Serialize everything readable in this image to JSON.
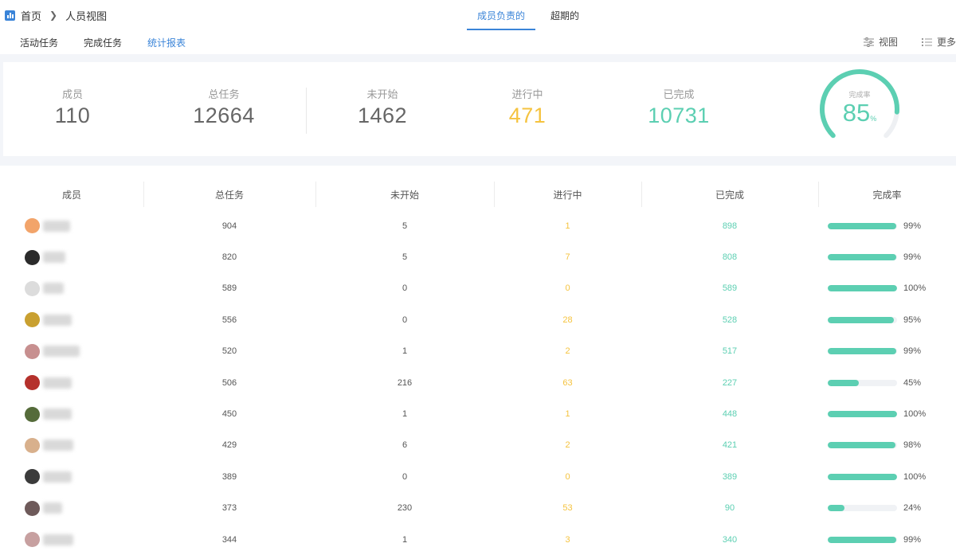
{
  "breadcrumb": {
    "home": "首页",
    "current": "人员视图"
  },
  "top_tabs": [
    {
      "label": "成员负责的",
      "active": true
    },
    {
      "label": "超期的",
      "active": false
    }
  ],
  "sub_tabs": [
    {
      "label": "活动任务",
      "active": false
    },
    {
      "label": "完成任务",
      "active": false
    },
    {
      "label": "统计报表",
      "active": true
    }
  ],
  "tools": {
    "view_label": "视图",
    "more_label": "更多"
  },
  "stats": {
    "members": {
      "label": "成员",
      "value": "110"
    },
    "total": {
      "label": "总任务",
      "value": "12664"
    },
    "not_started": {
      "label": "未开始",
      "value": "1462"
    },
    "in_progress": {
      "label": "进行中",
      "value": "471"
    },
    "completed": {
      "label": "已完成",
      "value": "10731"
    },
    "rate": {
      "label": "完成率",
      "value": "85",
      "unit": "%",
      "fraction": 0.85
    }
  },
  "colors": {
    "accent": "#3a84d8",
    "in_progress": "#f5c33f",
    "completed": "#5ccfb2",
    "muted": "#999999"
  },
  "table": {
    "headers": [
      "成员",
      "总任务",
      "未开始",
      "进行中",
      "已完成",
      "完成率"
    ],
    "rows": [
      {
        "total": "904",
        "not_started": "5",
        "in_progress": "1",
        "completed": "898",
        "rate": "99%",
        "fill": 0.99,
        "avatar": "#f2a46a",
        "name_w": 34
      },
      {
        "total": "820",
        "not_started": "5",
        "in_progress": "7",
        "completed": "808",
        "rate": "99%",
        "fill": 0.99,
        "avatar": "#2b2b2b",
        "name_w": 28
      },
      {
        "total": "589",
        "not_started": "0",
        "in_progress": "0",
        "completed": "589",
        "rate": "100%",
        "fill": 1.0,
        "avatar": "#dcdcdc",
        "name_w": 26
      },
      {
        "total": "556",
        "not_started": "0",
        "in_progress": "28",
        "completed": "528",
        "rate": "95%",
        "fill": 0.95,
        "avatar": "#c9a030",
        "name_w": 36
      },
      {
        "total": "520",
        "not_started": "1",
        "in_progress": "2",
        "completed": "517",
        "rate": "99%",
        "fill": 0.99,
        "avatar": "#c78f8f",
        "name_w": 46
      },
      {
        "total": "506",
        "not_started": "216",
        "in_progress": "63",
        "completed": "227",
        "rate": "45%",
        "fill": 0.45,
        "avatar": "#b5312c",
        "name_w": 36
      },
      {
        "total": "450",
        "not_started": "1",
        "in_progress": "1",
        "completed": "448",
        "rate": "100%",
        "fill": 1.0,
        "avatar": "#556b3a",
        "name_w": 36
      },
      {
        "total": "429",
        "not_started": "6",
        "in_progress": "2",
        "completed": "421",
        "rate": "98%",
        "fill": 0.98,
        "avatar": "#d8b08c",
        "name_w": 38
      },
      {
        "total": "389",
        "not_started": "0",
        "in_progress": "0",
        "completed": "389",
        "rate": "100%",
        "fill": 1.0,
        "avatar": "#3b3b3b",
        "name_w": 36
      },
      {
        "total": "373",
        "not_started": "230",
        "in_progress": "53",
        "completed": "90",
        "rate": "24%",
        "fill": 0.24,
        "avatar": "#6e5a5a",
        "name_w": 24
      },
      {
        "total": "344",
        "not_started": "1",
        "in_progress": "3",
        "completed": "340",
        "rate": "99%",
        "fill": 0.99,
        "avatar": "#c7a0a0",
        "name_w": 38
      }
    ]
  }
}
